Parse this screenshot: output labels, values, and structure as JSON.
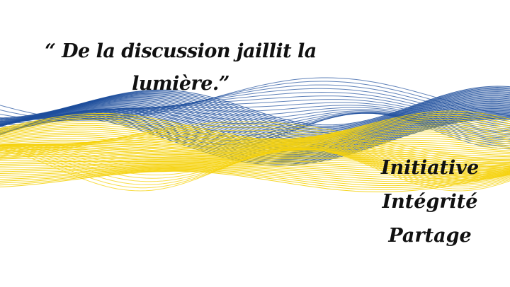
{
  "quote": {
    "line1": "“ De la discussion jaillit la",
    "line2": "lumière.”"
  },
  "values": [
    "Initiative",
    "Intégrité",
    "Partage"
  ],
  "colors": {
    "background": "#ffffff",
    "blue": "#1e4f9c",
    "yellow": "#f5d20a",
    "text": "#111111"
  }
}
